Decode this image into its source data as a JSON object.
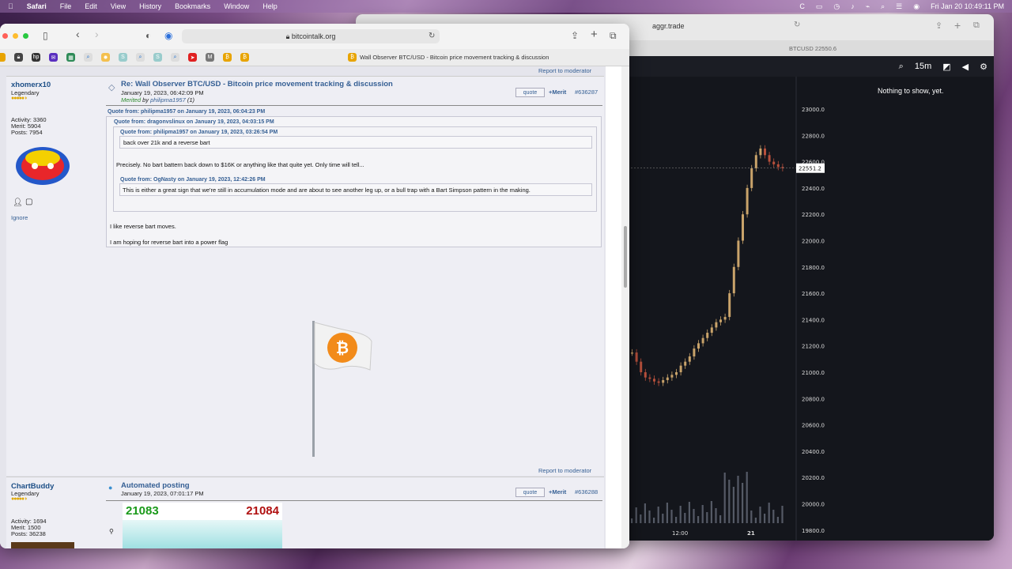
{
  "menubar": {
    "app": "Safari",
    "items": [
      "File",
      "Edit",
      "View",
      "History",
      "Bookmarks",
      "Window",
      "Help"
    ],
    "clock": "Fri Jan 20  10:49:11 PM"
  },
  "aggr": {
    "url": "aggr.trade",
    "tab": "BTCUSD 22550.6",
    "interval": "15m",
    "nothing": "Nothing to show, yet.",
    "price_label": "22551.2",
    "yticks": [
      "23000.0",
      "22800.0",
      "22600.0",
      "22400.0",
      "22200.0",
      "22000.0",
      "21800.0",
      "21600.0",
      "21400.0",
      "21200.0",
      "21000.0",
      "20800.0",
      "20600.0",
      "20400.0",
      "20200.0",
      "20000.0",
      "19800.0"
    ],
    "xticks": [
      "12:00",
      "21"
    ]
  },
  "safari": {
    "url": "bitcointalk.org",
    "tab_title": "Wall Observer BTC/USD - Bitcoin price movement tracking & discussion"
  },
  "post1": {
    "user": "xhomerx10",
    "rank": "Legendary",
    "activity": "Activity: 3360",
    "merit": "Merit: 5904",
    "posts": "Posts: 7954",
    "ignore": "Ignore",
    "title": "Re: Wall Observer BTC/USD - Bitcoin price movement tracking & discussion",
    "date": "January 19, 2023, 06:42:09 PM",
    "merited_label": "Merited",
    "merited_by": "by",
    "merited_user": "philipma1957",
    "merited_count": "(1)",
    "quote_btn": "quote",
    "merit_btn": "+Merit",
    "msgid": "#636287",
    "report": "Report to moderator",
    "q1": "Quote from: philipma1957 on January 19, 2023, 06:04:23 PM",
    "q2": "Quote from: dragonvslinux on January 19, 2023, 04:03:15 PM",
    "q3": "Quote from: philipma1957 on January 19, 2023, 03:26:54 PM",
    "q3_text": "back over 21k and a reverse bart",
    "q2_text": "Precisely. No bart battern back down to $16K or anything like that quite yet. Only time will tell...",
    "q4": "Quote from: OgNasty on January 19, 2023, 12:42:26 PM",
    "q4_text": "This is either a great sign that we're still in accumulation mode and are about to see another leg up, or a bull trap with a Bart Simpson pattern in the making.",
    "body1": "I like reverse bart moves.",
    "body2": "I am hoping for reverse bart into a power flag",
    "report2": "Report to moderator"
  },
  "post2": {
    "user": "ChartBuddy",
    "rank": "Legendary",
    "activity": "Activity: 1694",
    "merit": "Merit: 1500",
    "posts": "Posts: 36238",
    "title": "Automated posting",
    "date": "January 19, 2023, 07:01:17 PM",
    "quote_btn": "quote",
    "merit_btn": "+Merit",
    "msgid": "#636288",
    "bid": "21083",
    "ask": "21084"
  }
}
